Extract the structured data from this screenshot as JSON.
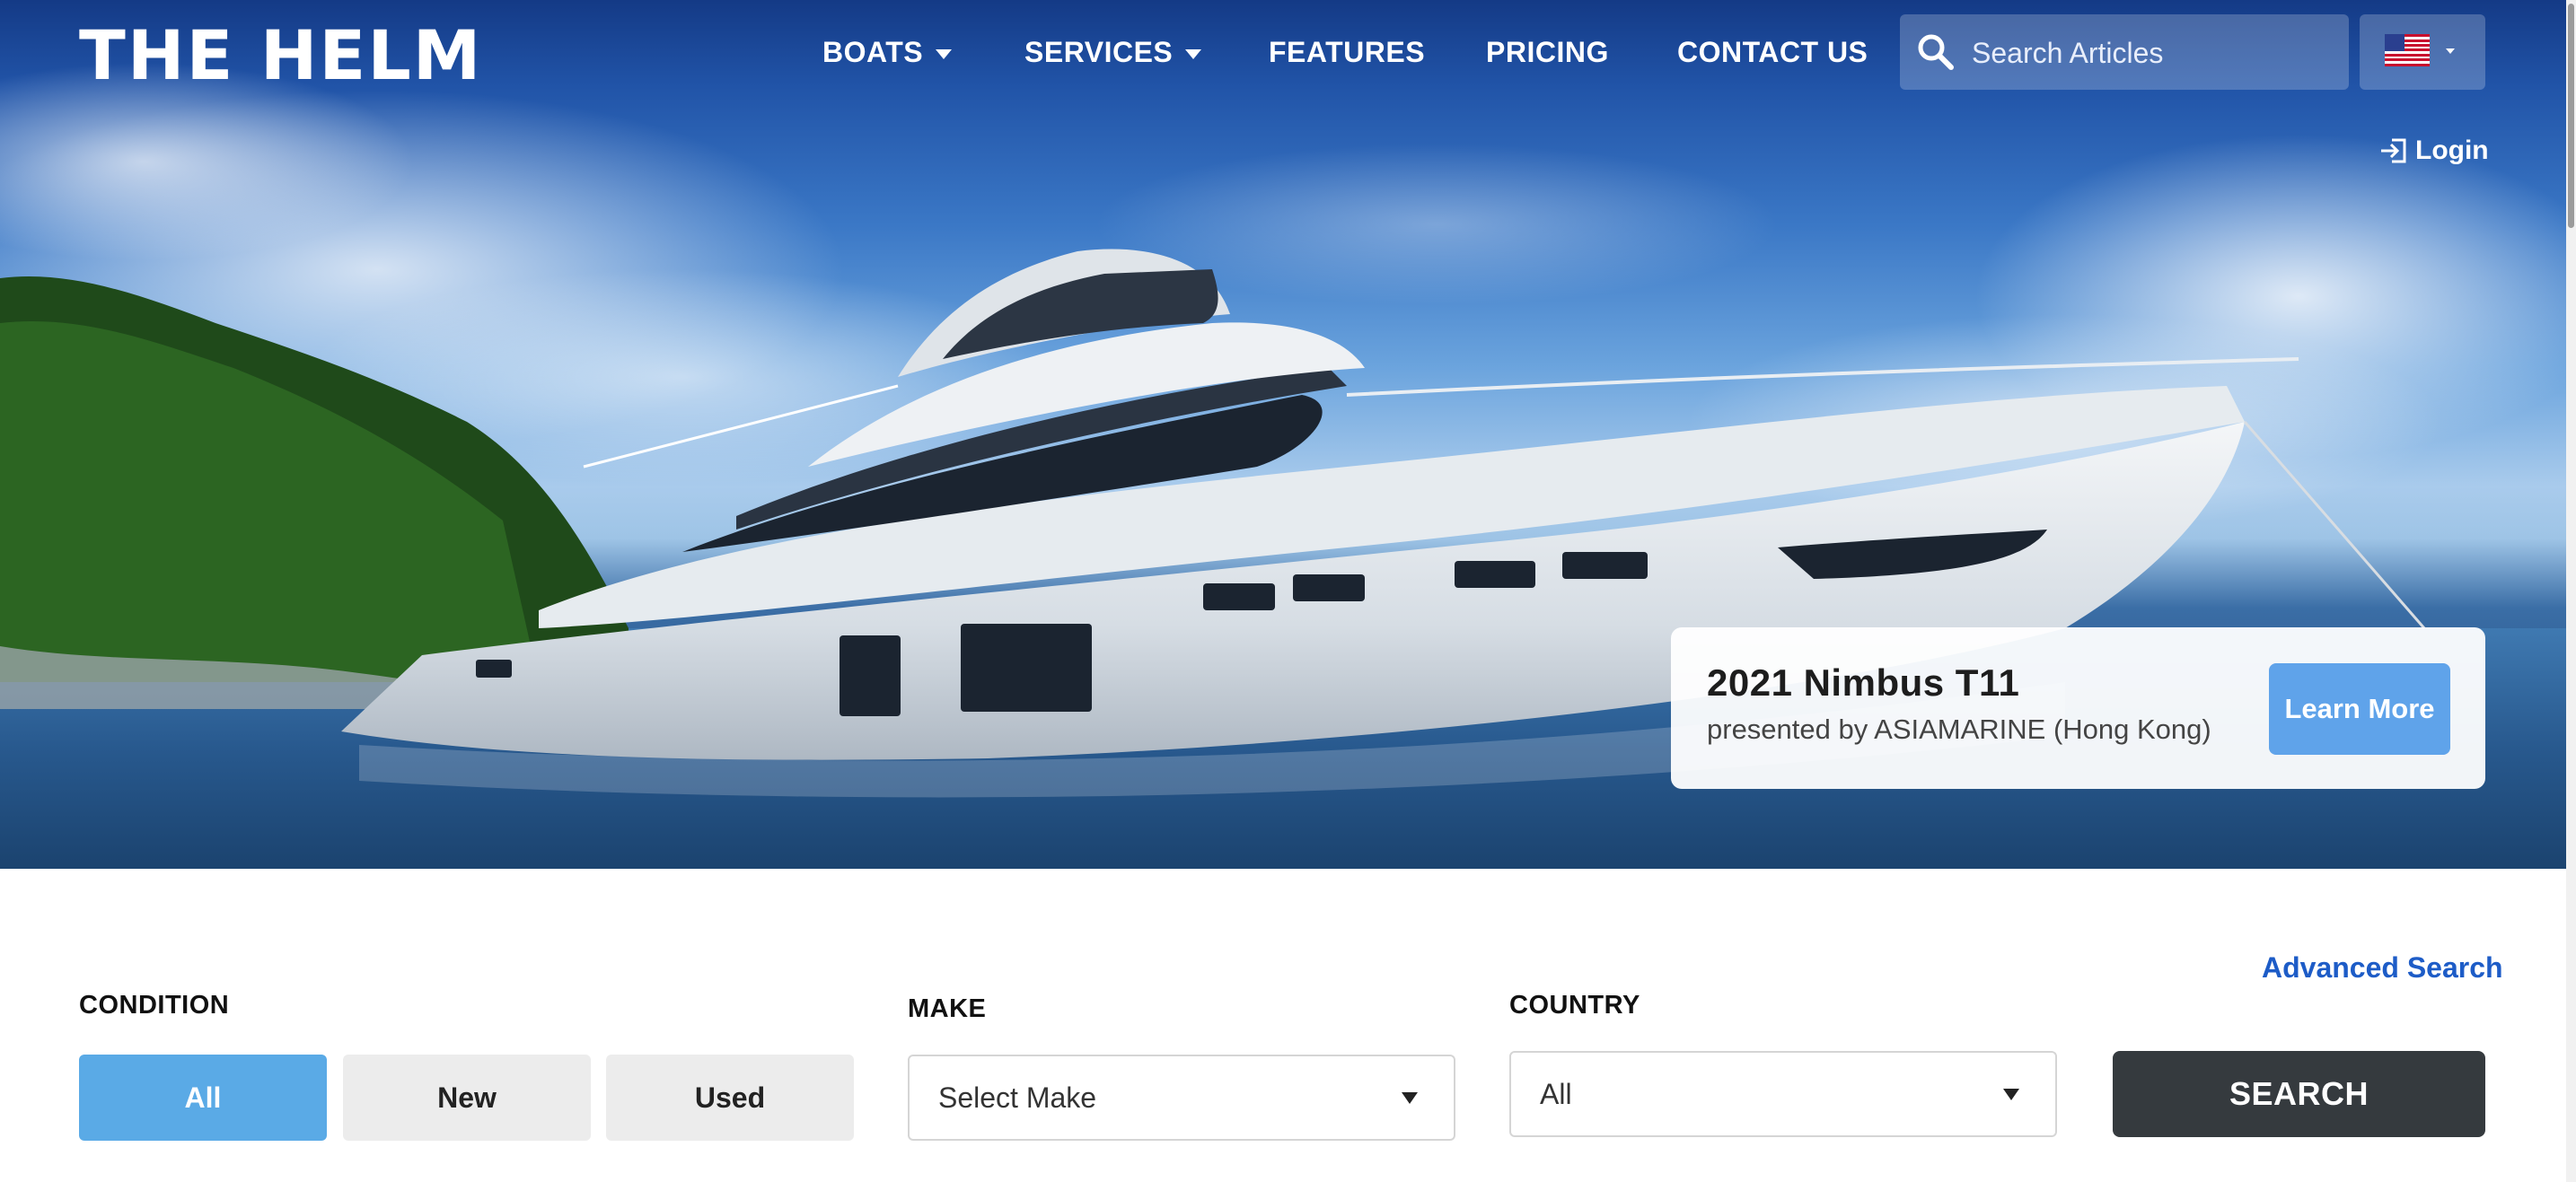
{
  "brand": {
    "logo_text": "THE HELM"
  },
  "nav": {
    "items": [
      {
        "label": "BOATS",
        "has_dropdown": true
      },
      {
        "label": "SERVICES",
        "has_dropdown": true
      },
      {
        "label": "FEATURES",
        "has_dropdown": false
      },
      {
        "label": "PRICING",
        "has_dropdown": false
      },
      {
        "label": "CONTACT US",
        "has_dropdown": false
      }
    ],
    "search": {
      "placeholder": "Search Articles",
      "value": "",
      "icon": "search-icon"
    },
    "language": {
      "icon": "us-flag-icon"
    },
    "login_label": "Login"
  },
  "promo": {
    "title": "2021 Nimbus T11",
    "subtitle": "presented by ASIAMARINE (Hong Kong)",
    "button_label": "Learn More"
  },
  "search_form": {
    "advanced_search_label": "Advanced Search",
    "condition": {
      "label": "CONDITION",
      "options": [
        "All",
        "New",
        "Used"
      ],
      "selected": "All"
    },
    "make": {
      "label": "MAKE",
      "value": "Select Make"
    },
    "country": {
      "label": "COUNTRY",
      "value": "All"
    },
    "submit_label": "SEARCH"
  },
  "colors": {
    "accent_blue": "#5aaae6",
    "link_blue": "#1d5cc7",
    "search_button": "#353a3e",
    "inactive_button": "#ececec"
  }
}
